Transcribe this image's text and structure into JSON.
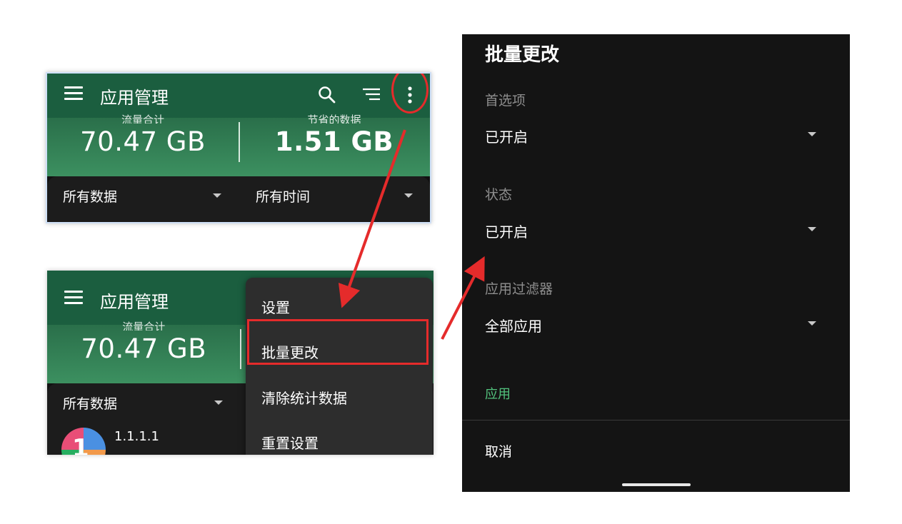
{
  "shot1": {
    "title": "应用管理",
    "stat_left_caption": "流量合计",
    "stat_left_value": "70.47 GB",
    "stat_right_caption": "节省的数据",
    "stat_right_value": "1.51 GB",
    "filter_data": "所有数据",
    "filter_time": "所有时间",
    "icons": [
      "menu-icon",
      "search-icon",
      "filter-icon",
      "more-vert-icon"
    ]
  },
  "shot2": {
    "title": "应用管理",
    "stat_left_caption": "流量合计",
    "stat_left_value": "70.47 GB",
    "filter_data": "所有数据",
    "app_name": "1.1.1.1",
    "app_icon_text": "1",
    "menu_items": [
      "设置",
      "批量更改",
      "清除统计数据",
      "重置设置"
    ]
  },
  "dialog": {
    "title": "批量更改",
    "preference_label": "首选项",
    "preference_value": "已开启",
    "state_label": "状态",
    "state_value": "已开启",
    "app_filter_label": "应用过滤器",
    "app_filter_value": "全部应用",
    "apply_label": "应用",
    "cancel_label": "取消"
  },
  "colors": {
    "appbar": "#1b5e3f",
    "highlight": "#e52b2b",
    "apply_text": "#52c27d",
    "dialog_bg": "#141414"
  }
}
